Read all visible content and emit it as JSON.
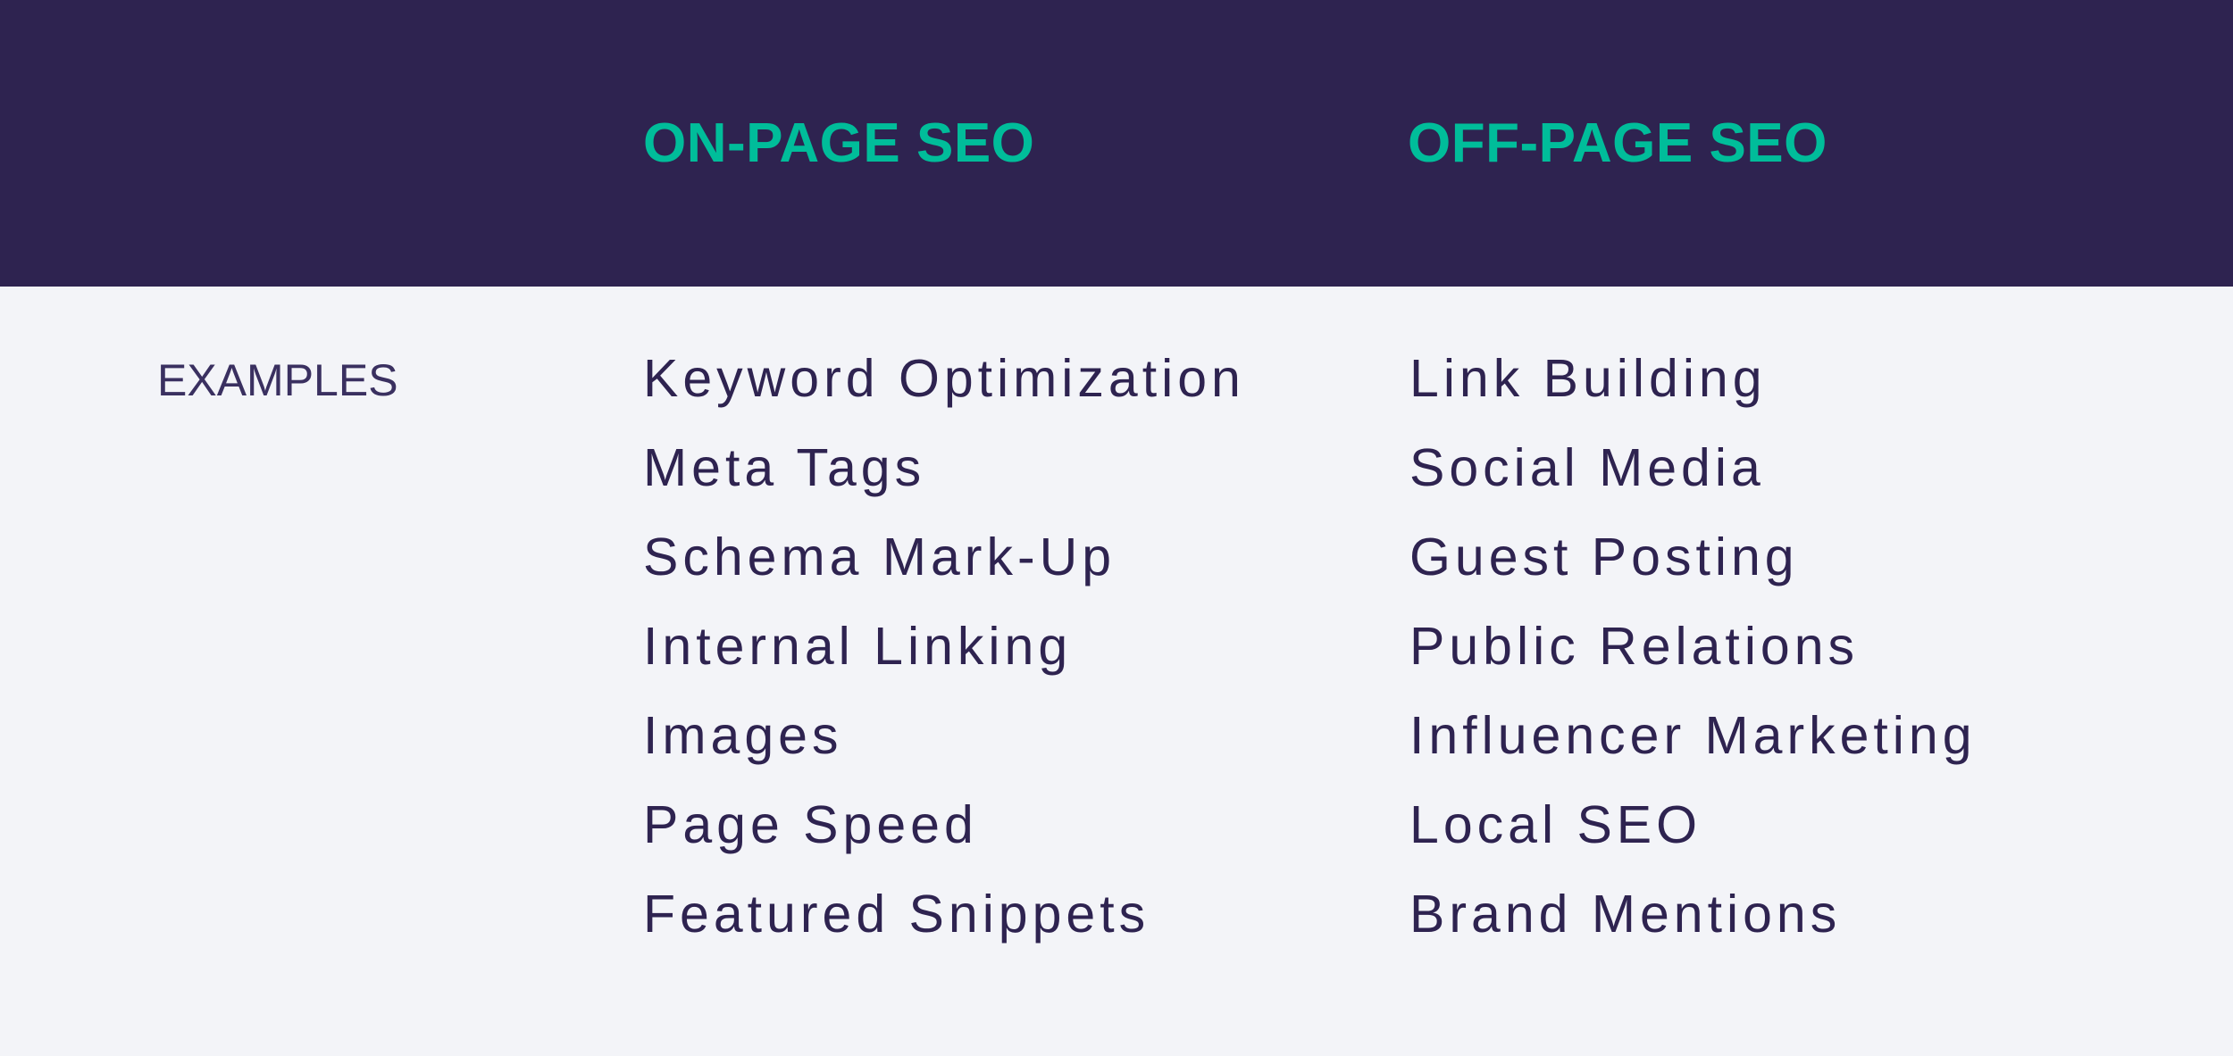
{
  "colors": {
    "header_background": "#2E2350",
    "body_background": "#F3F4F8",
    "accent": "#00BD9A",
    "text": "#2E2350"
  },
  "table": {
    "columns": [
      {
        "heading": "ON-PAGE SEO",
        "examples": [
          "Keyword Optimization",
          "Meta Tags",
          "Schema Mark-Up",
          "Internal Linking",
          "Images",
          "Page Speed",
          "Featured Snippets"
        ]
      },
      {
        "heading": "OFF-PAGE SEO",
        "examples": [
          "Link Building",
          "Social Media",
          "Guest Posting",
          "Public Relations",
          "Influencer Marketing",
          "Local SEO",
          "Brand Mentions"
        ]
      }
    ],
    "row_label": "EXAMPLES"
  }
}
